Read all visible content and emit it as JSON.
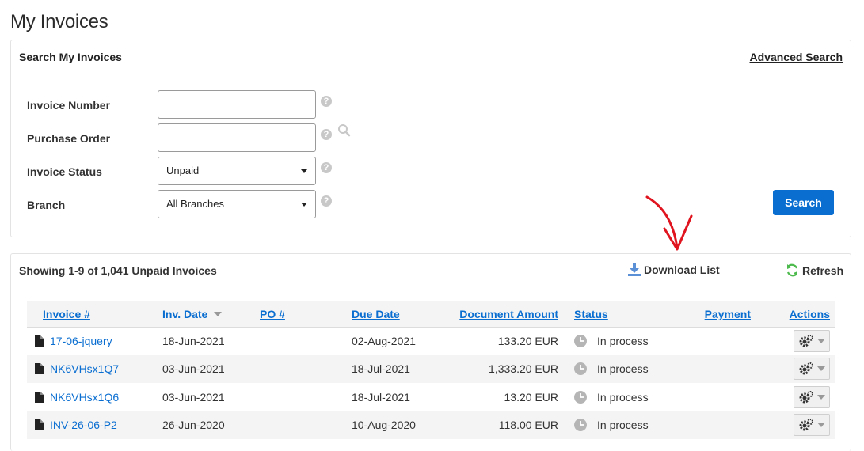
{
  "page": {
    "title": "My Invoices"
  },
  "search_panel": {
    "title": "Search My Invoices",
    "advanced_search": "Advanced Search",
    "fields": {
      "invoice_number": {
        "label": "Invoice Number",
        "value": ""
      },
      "purchase_order": {
        "label": "Purchase Order",
        "value": ""
      },
      "invoice_status": {
        "label": "Invoice Status",
        "selected": "Unpaid"
      },
      "branch": {
        "label": "Branch",
        "selected": "All Branches"
      }
    },
    "help_glyph": "?",
    "search_button": "Search"
  },
  "results": {
    "summary": "Showing 1-9 of 1,041 Unpaid Invoices",
    "download_list": "Download List",
    "refresh": "Refresh",
    "columns": {
      "invoice": "Invoice #",
      "inv_date": "Inv. Date",
      "po": "PO #",
      "due_date": "Due Date",
      "amount": "Document Amount",
      "status": "Status",
      "payment": "Payment",
      "actions": "Actions"
    },
    "rows": [
      {
        "invoice": "17-06-jquery",
        "inv_date": "18-Jun-2021",
        "po": "",
        "due_date": "02-Aug-2021",
        "amount": "133.20 EUR",
        "status": "In process",
        "payment": ""
      },
      {
        "invoice": "NK6VHsx1Q7",
        "inv_date": "03-Jun-2021",
        "po": "",
        "due_date": "18-Jul-2021",
        "amount": "1,333.20 EUR",
        "status": "In process",
        "payment": ""
      },
      {
        "invoice": "NK6VHsx1Q6",
        "inv_date": "03-Jun-2021",
        "po": "",
        "due_date": "18-Jul-2021",
        "amount": "13.20 EUR",
        "status": "In process",
        "payment": ""
      },
      {
        "invoice": "INV-26-06-P2",
        "inv_date": "26-Jun-2020",
        "po": "",
        "due_date": "10-Aug-2020",
        "amount": "118.00 EUR",
        "status": "In process",
        "payment": ""
      }
    ]
  },
  "colors": {
    "link_blue": "#0a6ed1",
    "button_blue": "#0a6ed1",
    "refresh_green": "#4cba4c",
    "annotation_red": "#e0141e"
  },
  "icons": [
    "help-icon",
    "search-lookup-icon",
    "download-icon",
    "refresh-icon",
    "document-icon",
    "clock-icon",
    "gear-icon",
    "chevron-down-icon",
    "annotation-arrow"
  ]
}
